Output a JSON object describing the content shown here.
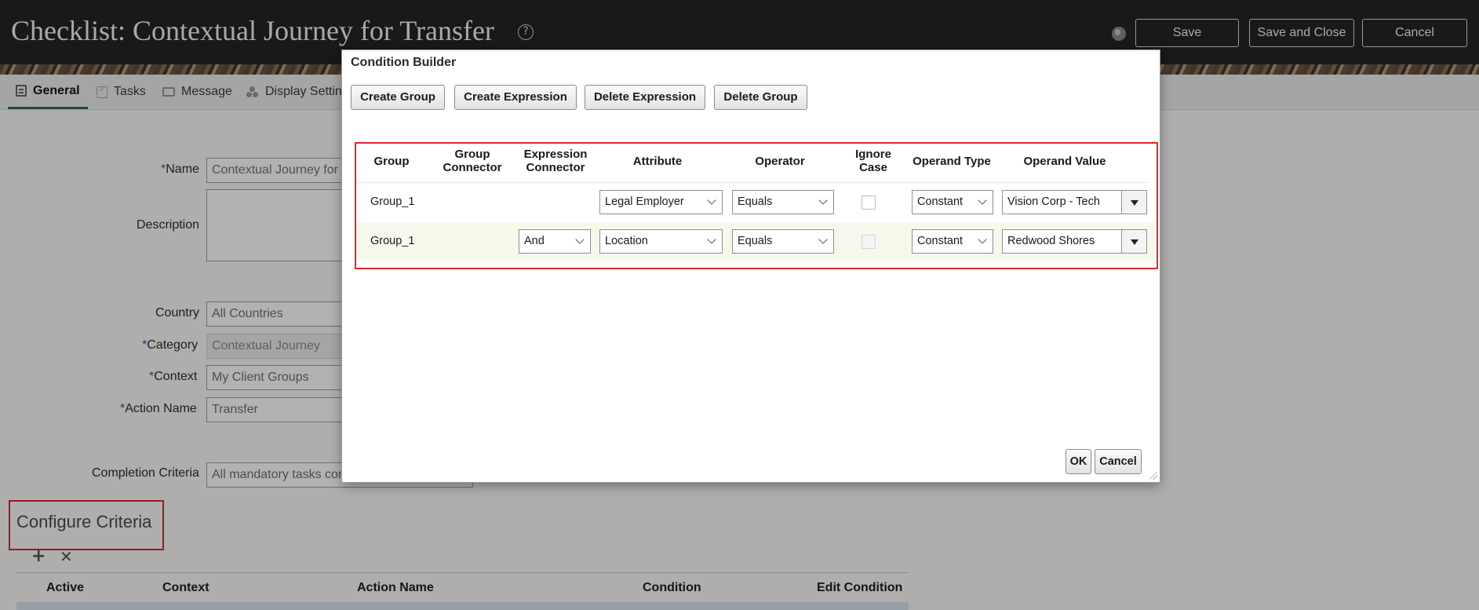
{
  "header": {
    "title": "Checklist: Contextual Journey for Transfer",
    "help_icon": "?",
    "save": "Save",
    "save_close": "Save and Close",
    "cancel": "Cancel"
  },
  "tabs": [
    {
      "label": "General",
      "icon": "general-icon",
      "active": true
    },
    {
      "label": "Tasks",
      "icon": "tasks-icon"
    },
    {
      "label": "Message",
      "icon": "message-icon"
    },
    {
      "label": "Display Settin",
      "icon": "display-settings-icon"
    }
  ],
  "form": {
    "name_label": "Name",
    "name_value": "Contextual Journey for T",
    "description_label": "Description",
    "country_label": "Country",
    "country_value": "All Countries",
    "category_label": "Category",
    "category_value": "Contextual Journey",
    "context_label": "Context",
    "context_value": "My Client Groups",
    "action_label": "Action Name",
    "action_value": "Transfer",
    "completion_label": "Completion Criteria",
    "completion_value": "All mandatory tasks com",
    "required_mark": "*"
  },
  "criteria": {
    "title": "Configure Criteria",
    "add_icon": "+",
    "remove_icon": "✕",
    "columns": [
      "Active",
      "Context",
      "Action Name",
      "Condition",
      "Edit Condition"
    ]
  },
  "dialog": {
    "title": "Condition Builder",
    "buttons": {
      "create_group": "Create Group",
      "create_expression": "Create Expression",
      "delete_expression": "Delete Expression",
      "delete_group": "Delete Group"
    },
    "columns": {
      "group": "Group",
      "group_connector_1": "Group",
      "group_connector_2": "Connector",
      "expression_connector_1": "Expression",
      "expression_connector_2": "Connector",
      "attribute": "Attribute",
      "operator": "Operator",
      "ignore_case_1": "Ignore",
      "ignore_case_2": "Case",
      "operand_type": "Operand Type",
      "operand_value": "Operand Value"
    },
    "rows": [
      {
        "group": "Group_1",
        "expression_connector": "",
        "attribute": "Legal Employer",
        "operator": "Equals",
        "ignore_case": false,
        "operand_type": "Constant",
        "operand_value": "Vision Corp - Tech"
      },
      {
        "group": "Group_1",
        "expression_connector": "And",
        "attribute": "Location",
        "operator": "Equals",
        "ignore_case": false,
        "operand_type": "Constant",
        "operand_value": "Redwood Shores"
      }
    ],
    "ok": "OK",
    "cancel": "Cancel"
  },
  "colors": {
    "header_bg": "#262523",
    "active_tab": "#356d45",
    "highlight": "#e0262b",
    "required": "#2a5ab4"
  }
}
